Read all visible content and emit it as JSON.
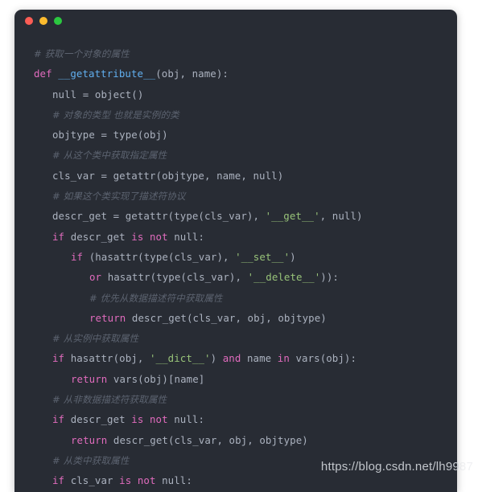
{
  "window": {
    "traffic_lights": [
      {
        "name": "close",
        "color": "#fc5d55"
      },
      {
        "name": "minimize",
        "color": "#fcbb2e"
      },
      {
        "name": "zoom",
        "color": "#2bc840"
      }
    ],
    "background": "#282c34",
    "page_background": "#ffffff"
  },
  "theme": {
    "comment": "#5c6370",
    "keyword": "#e06bbd",
    "function": "#61afef",
    "string": "#98c379",
    "plain": "#abb2bf"
  },
  "code": {
    "language": "python",
    "lines": [
      {
        "indent": 0,
        "tokens": [
          {
            "t": "cmt",
            "v": "# 获取一个对象的属性"
          }
        ]
      },
      {
        "indent": 0,
        "tokens": [
          {
            "t": "kw",
            "v": "def "
          },
          {
            "t": "fn",
            "v": "__getattribute__"
          },
          {
            "t": "pl",
            "v": "(obj, name):"
          }
        ]
      },
      {
        "indent": 1,
        "tokens": [
          {
            "t": "pl",
            "v": "null = object()"
          }
        ]
      },
      {
        "indent": 1,
        "tokens": [
          {
            "t": "cmt",
            "v": "# 对象的类型 也就是实例的类"
          }
        ]
      },
      {
        "indent": 1,
        "tokens": [
          {
            "t": "pl",
            "v": "objtype = type(obj)"
          }
        ]
      },
      {
        "indent": 1,
        "tokens": [
          {
            "t": "cmt",
            "v": "# 从这个类中获取指定属性"
          }
        ]
      },
      {
        "indent": 1,
        "tokens": [
          {
            "t": "pl",
            "v": "cls_var = getattr(objtype, name, null)"
          }
        ]
      },
      {
        "indent": 1,
        "tokens": [
          {
            "t": "cmt",
            "v": "# 如果这个类实现了描述符协议"
          }
        ]
      },
      {
        "indent": 1,
        "tokens": [
          {
            "t": "pl",
            "v": "descr_get = getattr(type(cls_var), "
          },
          {
            "t": "str",
            "v": "'__get__'"
          },
          {
            "t": "pl",
            "v": ", null)"
          }
        ]
      },
      {
        "indent": 1,
        "tokens": [
          {
            "t": "kw",
            "v": "if "
          },
          {
            "t": "pl",
            "v": "descr_get "
          },
          {
            "t": "kw",
            "v": "is not "
          },
          {
            "t": "pl",
            "v": "null:"
          }
        ]
      },
      {
        "indent": 2,
        "tokens": [
          {
            "t": "kw",
            "v": "if "
          },
          {
            "t": "pl",
            "v": "(hasattr(type(cls_var), "
          },
          {
            "t": "str",
            "v": "'__set__'"
          },
          {
            "t": "pl",
            "v": ")"
          }
        ]
      },
      {
        "indent": 3,
        "tokens": [
          {
            "t": "kw",
            "v": "or "
          },
          {
            "t": "pl",
            "v": "hasattr(type(cls_var), "
          },
          {
            "t": "str",
            "v": "'__delete__'"
          },
          {
            "t": "pl",
            "v": ")):"
          }
        ]
      },
      {
        "indent": 3,
        "tokens": [
          {
            "t": "cmt",
            "v": "# 优先从数据描述符中获取属性"
          }
        ]
      },
      {
        "indent": 3,
        "tokens": [
          {
            "t": "kw",
            "v": "return "
          },
          {
            "t": "pl",
            "v": "descr_get(cls_var, obj, objtype)"
          }
        ]
      },
      {
        "indent": 1,
        "tokens": [
          {
            "t": "cmt",
            "v": "# 从实例中获取属性"
          }
        ]
      },
      {
        "indent": 1,
        "tokens": [
          {
            "t": "kw",
            "v": "if "
          },
          {
            "t": "pl",
            "v": "hasattr(obj, "
          },
          {
            "t": "str",
            "v": "'__dict__'"
          },
          {
            "t": "pl",
            "v": ") "
          },
          {
            "t": "kw",
            "v": "and "
          },
          {
            "t": "pl",
            "v": "name "
          },
          {
            "t": "kw",
            "v": "in "
          },
          {
            "t": "pl",
            "v": "vars(obj):"
          }
        ]
      },
      {
        "indent": 2,
        "tokens": [
          {
            "t": "kw",
            "v": "return "
          },
          {
            "t": "pl",
            "v": "vars(obj)[name]"
          }
        ]
      },
      {
        "indent": 1,
        "tokens": [
          {
            "t": "cmt",
            "v": "# 从非数据描述符获取属性"
          }
        ]
      },
      {
        "indent": 1,
        "tokens": [
          {
            "t": "kw",
            "v": "if "
          },
          {
            "t": "pl",
            "v": "descr_get "
          },
          {
            "t": "kw",
            "v": "is not "
          },
          {
            "t": "pl",
            "v": "null:"
          }
        ]
      },
      {
        "indent": 2,
        "tokens": [
          {
            "t": "kw",
            "v": "return "
          },
          {
            "t": "pl",
            "v": "descr_get(cls_var, obj, objtype)"
          }
        ]
      },
      {
        "indent": 1,
        "tokens": [
          {
            "t": "cmt",
            "v": "# 从类中获取属性"
          }
        ]
      },
      {
        "indent": 1,
        "tokens": [
          {
            "t": "kw",
            "v": "if "
          },
          {
            "t": "pl",
            "v": "cls_var "
          },
          {
            "t": "kw",
            "v": "is not "
          },
          {
            "t": "pl",
            "v": "null:"
          }
        ]
      }
    ]
  },
  "watermark": {
    "text_visible": "https://blog.csdn.net/lh99",
    "text_faded": "87",
    "full": "https://blog.csdn.net/lh9987"
  }
}
